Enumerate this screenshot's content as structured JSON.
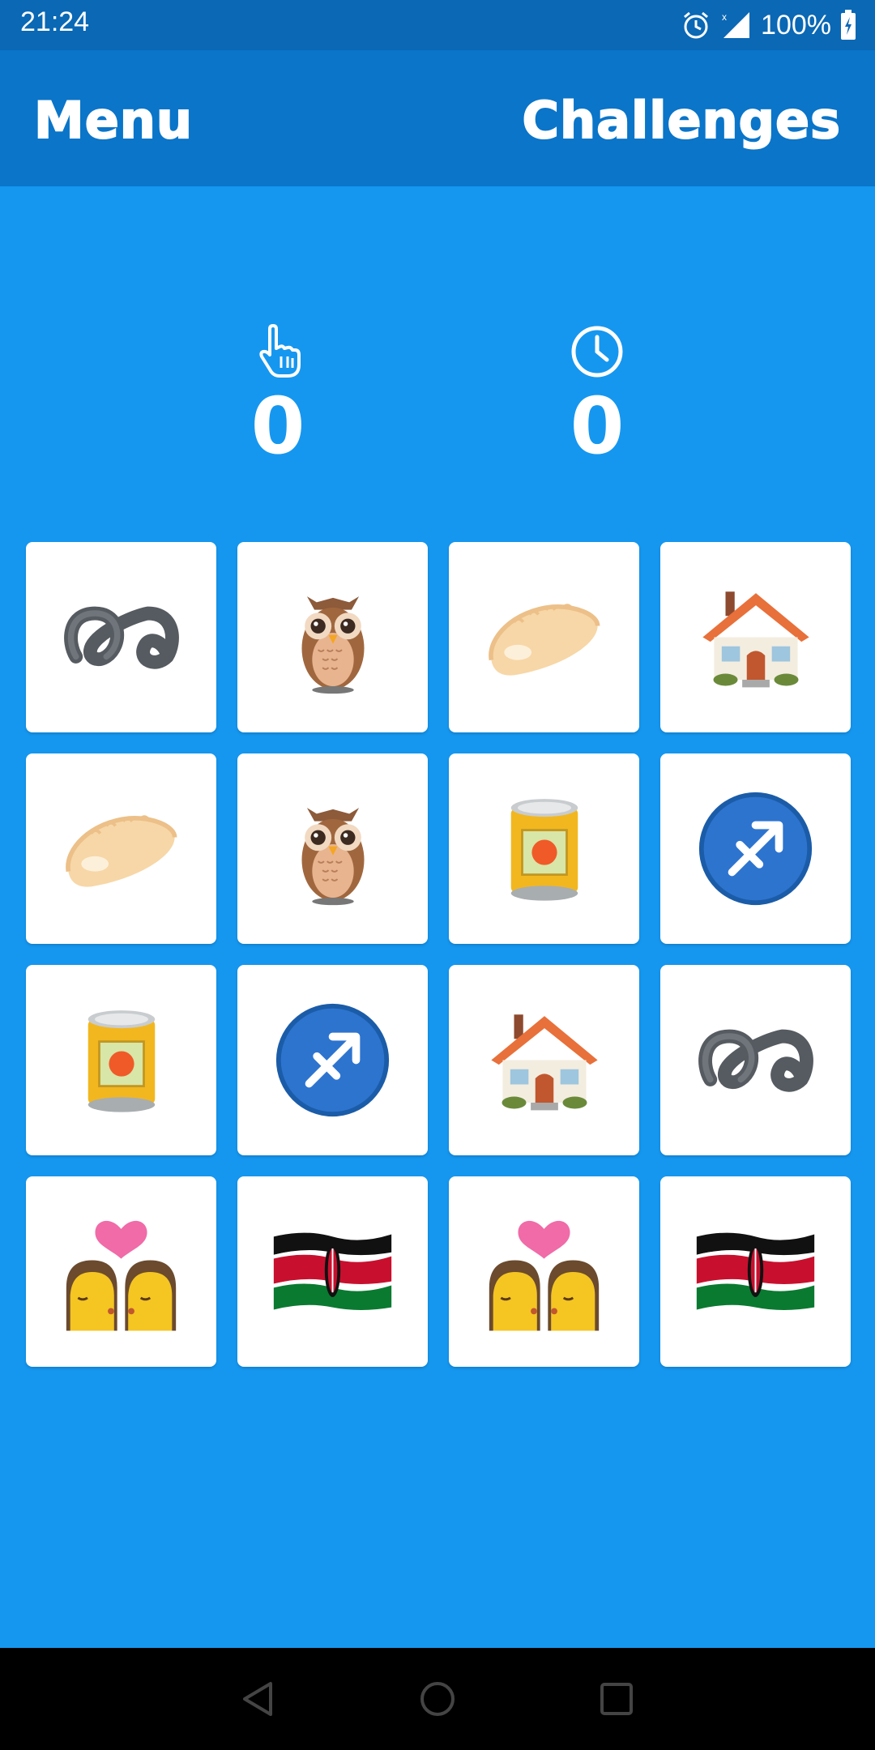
{
  "status_bar": {
    "time": "21:24",
    "battery": "100%",
    "icons": [
      "alarm-icon",
      "signal-icon",
      "battery-icon"
    ]
  },
  "app_bar": {
    "menu_label": "Menu",
    "challenges_label": "Challenges"
  },
  "stats": {
    "taps_icon": "pointing-hand-icon",
    "taps_value": "0",
    "time_icon": "clock-icon",
    "time_value": "0"
  },
  "cards": [
    [
      "double-curly-loop",
      "owl",
      "dumpling",
      "house"
    ],
    [
      "dumpling",
      "owl",
      "canned-food",
      "sagittarius"
    ],
    [
      "canned-food",
      "sagittarius",
      "house",
      "double-curly-loop"
    ],
    [
      "kiss-woman-woman",
      "flag-kenya",
      "kiss-woman-woman",
      "flag-kenya"
    ]
  ],
  "nav_bar": {
    "icons": [
      "back-icon",
      "home-icon",
      "recents-icon"
    ]
  },
  "colors": {
    "background": "#1597f0",
    "app_bar": "#0a75c9",
    "status_bar": "#0a68b5",
    "card": "#ffffff"
  }
}
